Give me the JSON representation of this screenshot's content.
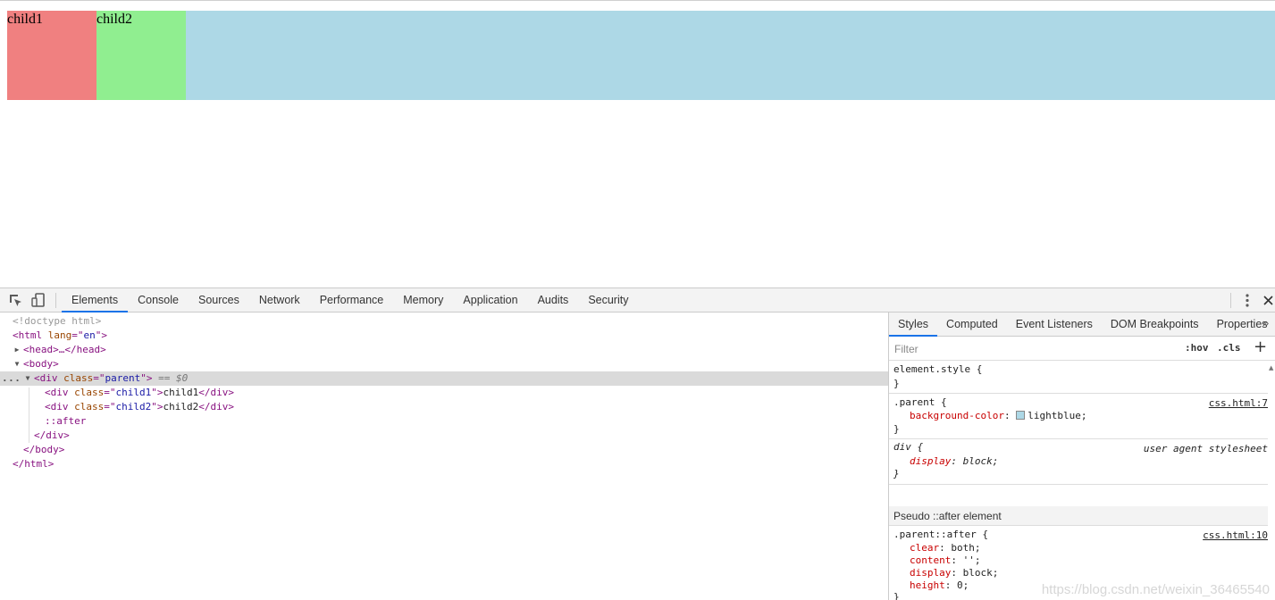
{
  "viewport": {
    "child1_text": "child1",
    "child2_text": "child2",
    "colors": {
      "child1": "#f08080",
      "child2": "#90ee90",
      "parent": "#add8e6"
    }
  },
  "toolbar": {
    "tabs": [
      "Elements",
      "Console",
      "Sources",
      "Network",
      "Performance",
      "Memory",
      "Application",
      "Audits",
      "Security"
    ],
    "active_tab": "Elements"
  },
  "dom": {
    "doctype": "<!doctype html>",
    "html_open_tag": "<html",
    "html_lang_attr": " lang",
    "html_lang_eq": "=\"",
    "html_lang_val": "en",
    "html_open_close": "\">",
    "head_line": "<head>…</head>",
    "body_open": "<body>",
    "div_open": "<div",
    "class_attr": " class",
    "eq_quote": "=\"",
    "parent_class": "parent",
    "quote_close": "\">",
    "selected_marker": " == $0",
    "child1_class": "child1",
    "child1_text": "child1",
    "child2_class": "child2",
    "child2_text": "child2",
    "div_close": "</div>",
    "after_pseudo": "::after",
    "body_close": "</body>",
    "html_close": "</html>",
    "dots": "..."
  },
  "sidebar": {
    "tabs": [
      "Styles",
      "Computed",
      "Event Listeners",
      "DOM Breakpoints",
      "Properties"
    ],
    "active_tab": "Styles",
    "more": "»",
    "filter_placeholder": "Filter",
    "hov": ":hov",
    "cls": ".cls",
    "add": "+",
    "element_style": {
      "selector": "element.style {",
      "close": "}"
    },
    "parent_rule": {
      "selector": ".parent {",
      "source": "css.html:7",
      "prop": "background-color",
      "value": "lightblue;",
      "swatch": "#add8e6",
      "close": "}"
    },
    "div_rule": {
      "selector": "div {",
      "source": "user agent stylesheet",
      "prop": "display",
      "value": "block;",
      "close": "}"
    },
    "pseudo_header": "Pseudo ::after element",
    "after_rule": {
      "selector": ".parent::after {",
      "source": "css.html:10",
      "props": [
        {
          "name": "clear",
          "value": "both;"
        },
        {
          "name": "content",
          "value": "'';"
        },
        {
          "name": "display",
          "value": "block;"
        },
        {
          "name": "height",
          "value": "0;"
        }
      ],
      "close": "}"
    },
    "watermark": "https://blog.csdn.net/weixin_36465540"
  }
}
